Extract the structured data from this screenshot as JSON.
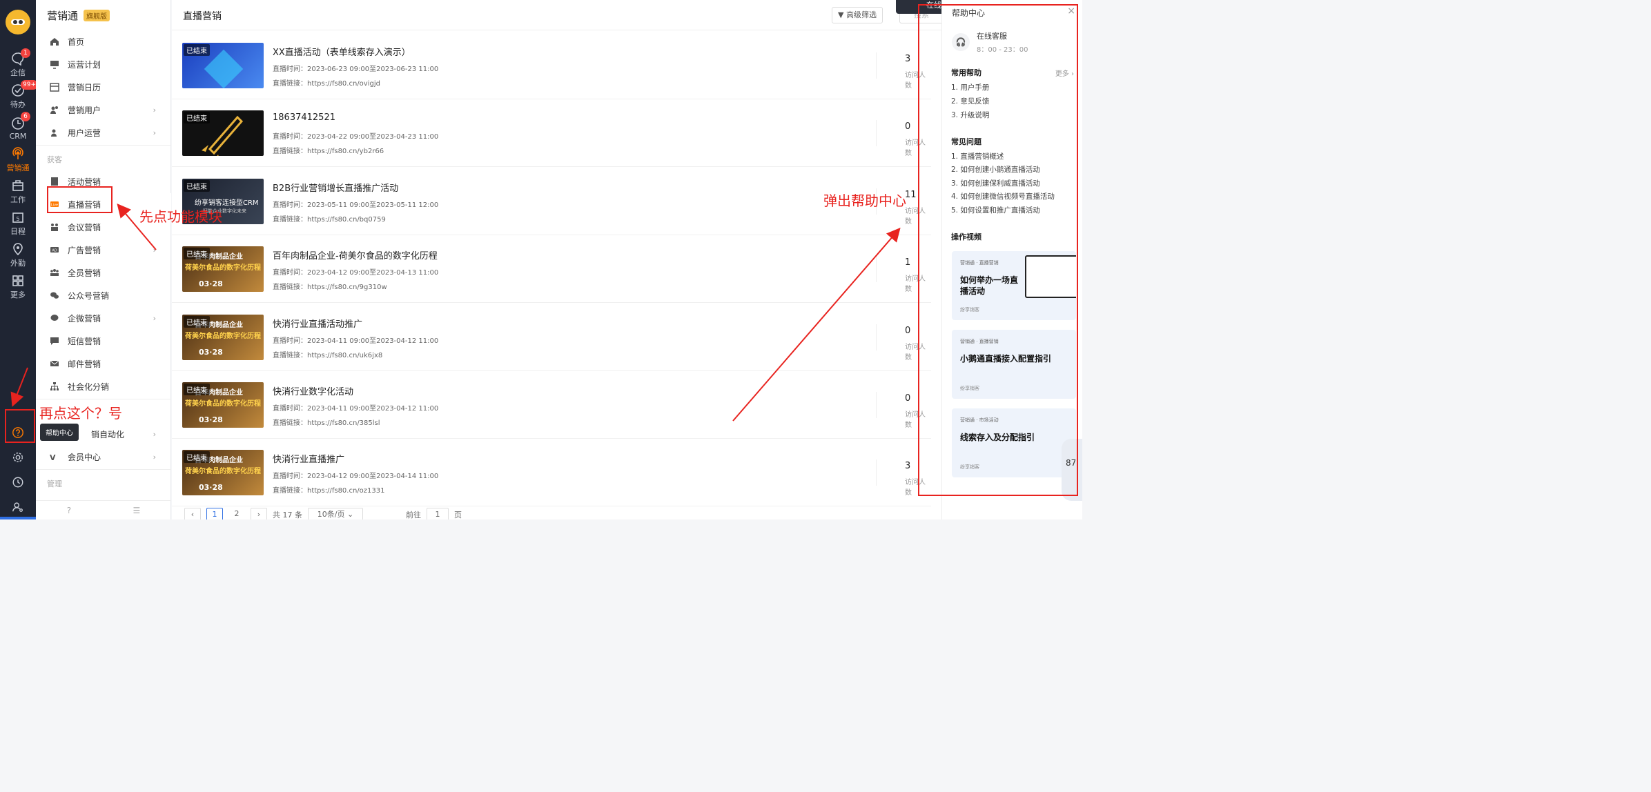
{
  "rail": {
    "items": [
      {
        "label": "企信",
        "badge": "1"
      },
      {
        "label": "待办",
        "badge": "99+"
      },
      {
        "label": "CRM",
        "badge": "6"
      },
      {
        "label": "营销通",
        "badge": ""
      },
      {
        "label": "工作",
        "badge": ""
      },
      {
        "label": "日程",
        "badge": ""
      },
      {
        "label": "外勤",
        "badge": ""
      },
      {
        "label": "更多",
        "badge": ""
      }
    ],
    "calendar_day": "5",
    "help_tooltip": "帮助中心"
  },
  "sidebar": {
    "title": "营销通",
    "edition": "旗舰版",
    "items": [
      {
        "label": "首页"
      },
      {
        "label": "运营计划"
      },
      {
        "label": "营销日历"
      },
      {
        "label": "营销用户"
      },
      {
        "label": "用户运营"
      }
    ],
    "group_acquire": "获客",
    "acquire_items": [
      {
        "label": "活动营销"
      },
      {
        "label": "直播营销"
      },
      {
        "label": "会议营销"
      },
      {
        "label": "广告营销"
      },
      {
        "label": "全员营销"
      },
      {
        "label": "公众号营销"
      },
      {
        "label": "企微营销"
      },
      {
        "label": "短信营销"
      },
      {
        "label": "邮件营销"
      },
      {
        "label": "社会化分销"
      }
    ],
    "tail_items": [
      {
        "label": "销自动化"
      },
      {
        "label": "会员中心"
      }
    ],
    "group_manage": "管理"
  },
  "main": {
    "page_title": "直播营销",
    "filter_label": "高级筛选",
    "search_placeholder": "搜索",
    "status_tag": "已结束",
    "count_label": "访问人数",
    "rows": [
      {
        "name": "XX直播活动（表单线索存入演示）",
        "time": "直播时间：2023-06-23 09:00至2023-06-23 11:00",
        "link": "直播链接：https://fs80.cn/ovigjd",
        "count": "3"
      },
      {
        "name": "18637412521",
        "time": "直播时间：2023-04-22 09:00至2023-04-23 11:00",
        "link": "直播链接：https://fs80.cn/yb2r66",
        "count": "0"
      },
      {
        "name": "B2B行业营销增长直播推广活动",
        "time": "直播时间：2023-05-11 09:00至2023-05-11 12:00",
        "link": "直播链接：https://fs80.cn/bq0759",
        "count": "11"
      },
      {
        "name": "百年肉制品企业-荷美尔食品的数字化历程",
        "time": "直播时间：2023-04-12 09:00至2023-04-13 11:00",
        "link": "直播链接：https://fs80.cn/9g310w",
        "count": "1"
      },
      {
        "name": "快消行业直播活动推广",
        "time": "直播时间：2023-04-11 09:00至2023-04-12 11:00",
        "link": "直播链接：https://fs80.cn/uk6jx8",
        "count": "0"
      },
      {
        "name": "快消行业数字化活动",
        "time": "直播时间：2023-04-11 09:00至2023-04-12 11:00",
        "link": "直播链接：https://fs80.cn/385lsl",
        "count": "0"
      },
      {
        "name": "快消行业直播推广",
        "time": "直播时间：2023-04-12 09:00至2023-04-14 11:00",
        "link": "直播链接：https://fs80.cn/oz1331",
        "count": "3"
      }
    ],
    "thumb_texts": {
      "rocket": "",
      "crm_title": "纷享销客连接型CRM",
      "crm_sub": "赋能企业数字化未来",
      "food_title": "百年肉制品企业",
      "food_sub": "荷美尔食品的数字化历程",
      "food_date": "03·28"
    },
    "pager": {
      "pages": [
        "1",
        "2"
      ],
      "total": "共 17 条",
      "page_size": "10条/页",
      "goto_prefix": "前往",
      "goto_value": "1",
      "goto_suffix": "页"
    }
  },
  "top_strip": "在线销售  XH",
  "help": {
    "title": "帮助中心",
    "service_label": "在线客服",
    "service_hours": "8：00 - 23：00",
    "common_title": "常用帮助",
    "more": "更多",
    "common_items": [
      "1. 用户手册",
      "2. 意见反馈",
      "3. 升级说明"
    ],
    "faq_title": "常见问题",
    "faq_items": [
      "1. 直播营销概述",
      "2. 如何创建小鹅通直播活动",
      "3. 如何创建保利威直播活动",
      "4. 如何创建微信视频号直播活动",
      "5. 如何设置和推广直播活动"
    ],
    "video_title": "操作视频",
    "cards": [
      {
        "tag": "营销通 · 直播营销",
        "title": "如何举办一场直播活动",
        "brand": "纷享销客"
      },
      {
        "tag": "营销通 · 直播营销",
        "title": "小鹅通直播接入配置指引",
        "brand": "纷享销客"
      },
      {
        "tag": "营销通 · 市场活动",
        "title": "线索存入及分配指引",
        "brand": "纷享销客"
      }
    ]
  },
  "annotations": {
    "step1": "先点功能模块",
    "step2": "再点这个？号",
    "step3": "弹出帮助中心"
  },
  "float_widget": "87",
  "colors": {
    "accent": "#ff7a00",
    "annotation": "#e8231f",
    "rail_bg": "#1f2533",
    "primary": "#2f6fe3"
  }
}
